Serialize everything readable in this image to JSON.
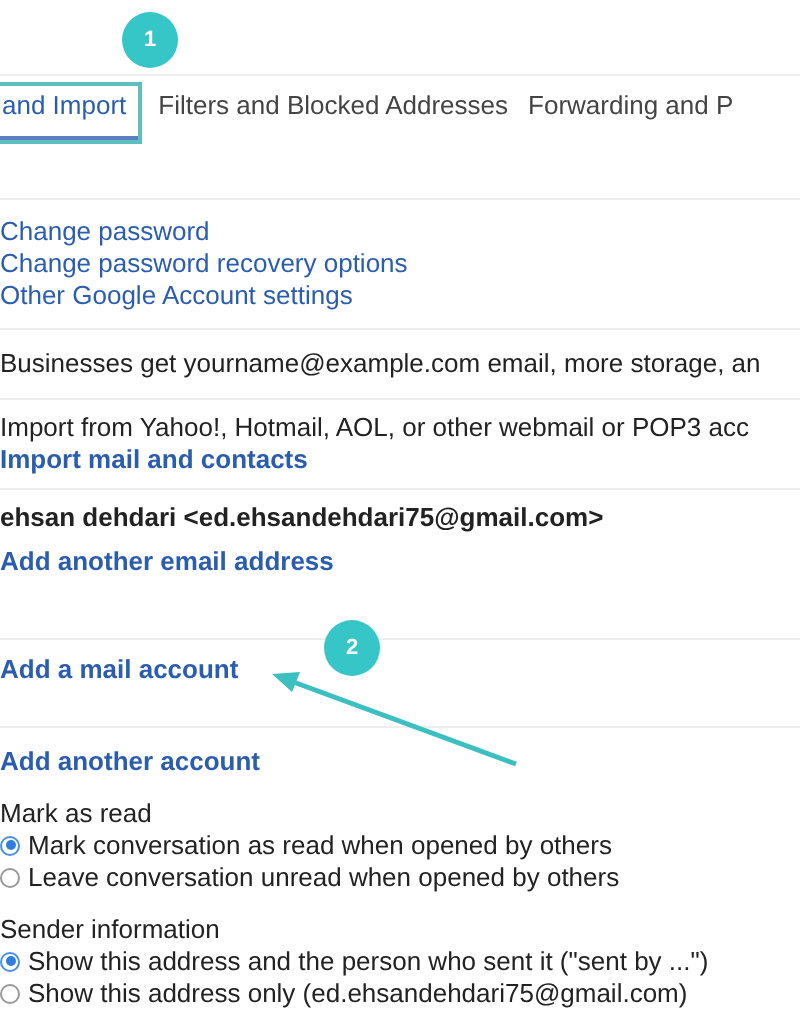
{
  "tabs": [
    {
      "label": "and Import",
      "selected": true
    },
    {
      "label": "Filters and Blocked Addresses",
      "selected": false
    },
    {
      "label": "Forwarding and P",
      "selected": false
    }
  ],
  "account_links": [
    "Change password",
    "Change password recovery options",
    "Other Google Account settings"
  ],
  "business_text": "Businesses get yourname@example.com email, more storage, an",
  "import": {
    "text": "Import from Yahoo!, Hotmail, AOL, or other webmail or POP3 acc",
    "link": "Import mail and contacts"
  },
  "send_as": {
    "address": "ehsan dehdari <ed.ehsandehdari75@gmail.com>",
    "link": "Add another email address"
  },
  "check_mail": {
    "link": "Add a mail account"
  },
  "grant_access": {
    "link": "Add another account"
  },
  "radio_groups": [
    {
      "title": "Mark as read",
      "options": [
        {
          "label": "Mark conversation as read when opened by others",
          "selected": true
        },
        {
          "label": "Leave conversation unread when opened by others",
          "selected": false
        }
      ]
    },
    {
      "title": "Sender information",
      "options": [
        {
          "label": "Show this address and the person who sent it (\"sent by ...\")",
          "selected": true
        },
        {
          "label": "Show this address only (ed.ehsandehdari75@gmail.com)",
          "selected": false
        }
      ]
    }
  ],
  "annotations": [
    {
      "number": "1"
    },
    {
      "number": "2"
    }
  ]
}
